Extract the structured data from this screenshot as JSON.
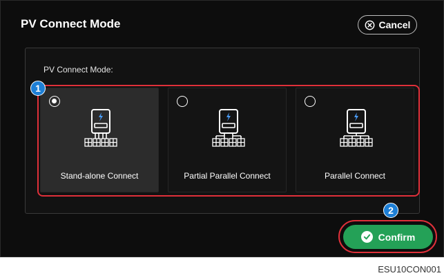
{
  "dialog": {
    "title": "PV Connect Mode",
    "cancel_label": "Cancel"
  },
  "panel": {
    "label": "PV Connect Mode:",
    "options": [
      {
        "label": "Stand-alone Connect",
        "selected": true
      },
      {
        "label": "Partial Parallel Connect",
        "selected": false
      },
      {
        "label": "Parallel Connect",
        "selected": false
      }
    ]
  },
  "annotations": {
    "badge_1": "1",
    "badge_2": "2"
  },
  "confirm_label": "Confirm",
  "footer": {
    "code": "ESU10CON001"
  },
  "colors": {
    "accent_green": "#24a157",
    "highlight_red": "#e0303a",
    "badge_blue": "#1d7fd6",
    "bolt_blue": "#4a9eff"
  },
  "icons": {
    "cancel": "circle-x-icon",
    "confirm": "check-circle-icon",
    "option": "inverter-panels-icon"
  }
}
